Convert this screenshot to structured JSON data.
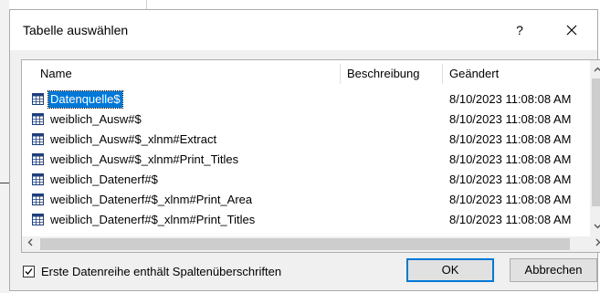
{
  "dialog": {
    "title": "Tabelle auswählen",
    "help": "?",
    "close_icon": "close-icon"
  },
  "list": {
    "columns": [
      "Name",
      "Beschreibung",
      "Geändert"
    ],
    "rows": [
      {
        "name": "Datenquelle$",
        "description": "",
        "modified": "8/10/2023 11:08:08 AM",
        "selected": true
      },
      {
        "name": "weiblich_Ausw#$",
        "description": "",
        "modified": "8/10/2023 11:08:08 AM"
      },
      {
        "name": "weiblich_Ausw#$_xlnm#Extract",
        "description": "",
        "modified": "8/10/2023 11:08:08 AM"
      },
      {
        "name": "weiblich_Ausw#$_xlnm#Print_Titles",
        "description": "",
        "modified": "8/10/2023 11:08:08 AM"
      },
      {
        "name": "weiblich_Datenerf#$",
        "description": "",
        "modified": "8/10/2023 11:08:08 AM"
      },
      {
        "name": "weiblich_Datenerf#$_xlnm#Print_Area",
        "description": "",
        "modified": "8/10/2023 11:08:08 AM"
      },
      {
        "name": "weiblich_Datenerf#$_xlnm#Print_Titles",
        "description": "",
        "modified": "8/10/2023 11:08:08 AM"
      }
    ],
    "row_icon": "table-icon"
  },
  "options": {
    "header_checkbox_label": "Erste Datenreihe enthält Spaltenüberschriften",
    "header_checkbox_checked": true
  },
  "buttons": {
    "ok": "OK",
    "cancel": "Abbrechen"
  },
  "colors": {
    "selection": "#0078d7",
    "dialog_bg": "#f0f0f0"
  }
}
